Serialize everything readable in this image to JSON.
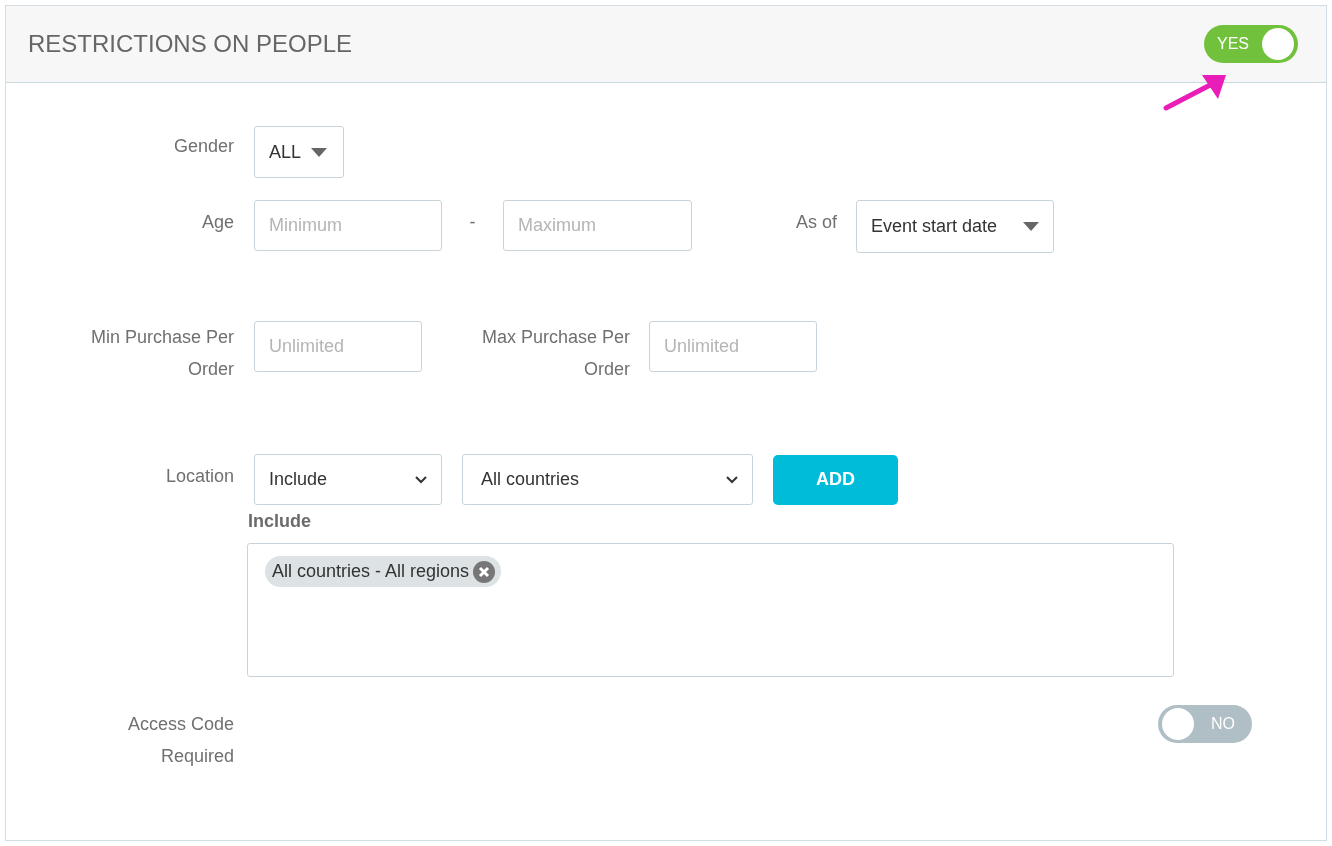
{
  "section": {
    "title": "RESTRICTIONS ON PEOPLE",
    "toggle": {
      "on": true,
      "label": "YES"
    }
  },
  "gender": {
    "label": "Gender",
    "value": "ALL"
  },
  "age": {
    "label": "Age",
    "min_placeholder": "Minimum",
    "separator": "-",
    "max_placeholder": "Maximum",
    "as_of_label": "As of",
    "as_of_value": "Event start date"
  },
  "purchase": {
    "min_label": "Min Purchase Per Order",
    "min_placeholder": "Unlimited",
    "max_label": "Max Purchase Per Order",
    "max_placeholder": "Unlimited"
  },
  "location": {
    "label": "Location",
    "mode": "Include",
    "country": "All countries",
    "add_button": "ADD",
    "list_heading": "Include",
    "tags": [
      "All countries - All regions"
    ]
  },
  "access_code": {
    "label": "Access Code Required",
    "toggle": {
      "on": false,
      "label": "NO"
    }
  }
}
